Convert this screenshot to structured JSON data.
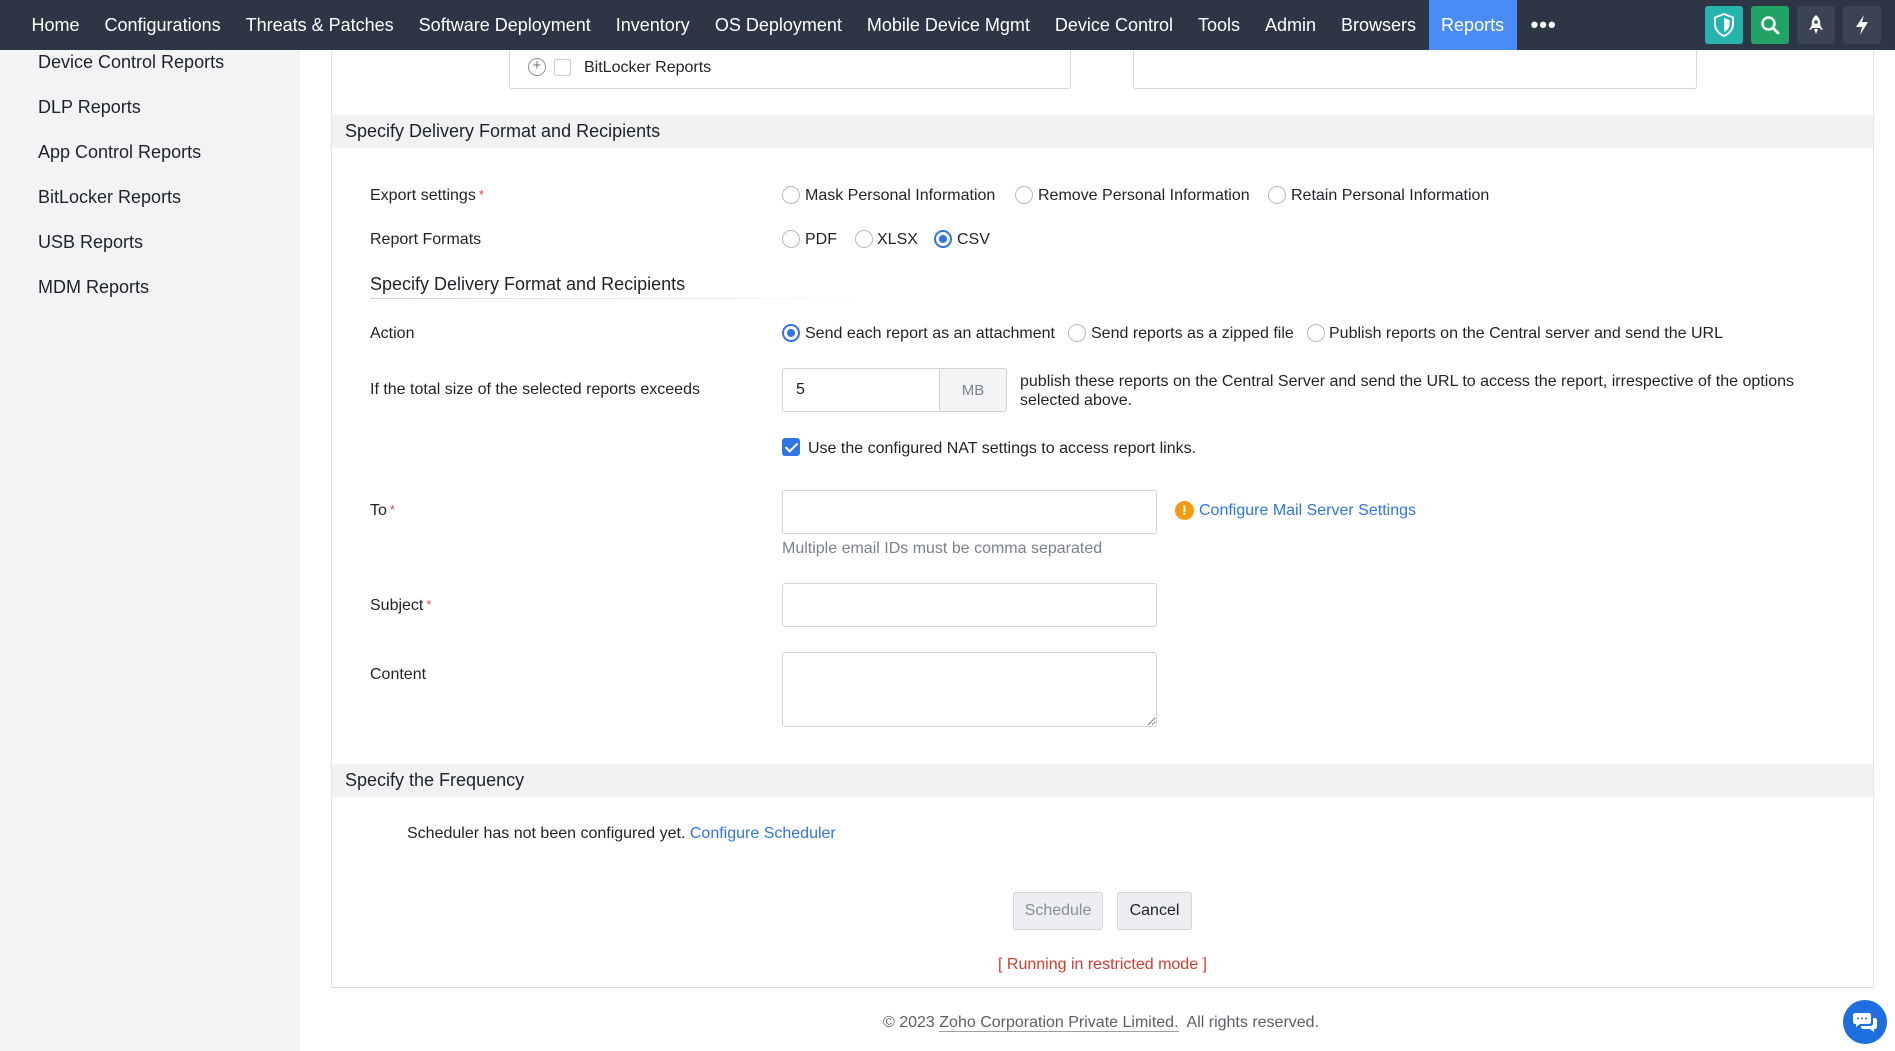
{
  "nav": {
    "items": [
      "Home",
      "Configurations",
      "Threats & Patches",
      "Software Deployment",
      "Inventory",
      "OS Deployment",
      "Mobile Device Mgmt",
      "Device Control",
      "Tools",
      "Admin",
      "Browsers",
      "Reports"
    ],
    "active": "Reports",
    "more_label": "•••",
    "icons": [
      "shield-icon",
      "search-icon",
      "rocket-icon",
      "bolt-icon"
    ],
    "colors": {
      "bar": "#2d3644",
      "active": "#4a8cf7",
      "shield": "#26b5ac",
      "search": "#21a366"
    }
  },
  "sidebar": {
    "items": [
      "Device Control Reports",
      "DLP Reports",
      "App Control Reports",
      "BitLocker Reports",
      "USB Reports",
      "MDM Reports"
    ]
  },
  "tree": {
    "item_label": "BitLocker Reports"
  },
  "delivery": {
    "section_title": "Specify Delivery Format and Recipients",
    "export_label": "Export settings",
    "export_options": [
      "Mask Personal Information",
      "Remove Personal Information",
      "Retain Personal Information"
    ],
    "format_label": "Report Formats",
    "format_options": [
      "PDF",
      "XLSX",
      "CSV"
    ],
    "format_selected": "CSV",
    "subheading": "Specify Delivery Format and Recipients",
    "action_label": "Action",
    "action_options": [
      "Send each report as an attachment",
      "Send reports as a zipped file",
      "Publish reports on the Central server and send the URL"
    ],
    "action_selected": "Send each report as an attachment",
    "size_label": "If the total size of the selected reports exceeds",
    "size_value": "5",
    "size_unit": "MB",
    "size_desc": "publish these reports on the Central Server and send the URL to access the report, irrespective of the options selected above.",
    "nat_label": "Use the configured NAT settings to access report links.",
    "nat_checked": true,
    "to_label": "To",
    "to_value": "",
    "to_hint": "Multiple email IDs must be comma separated",
    "mail_link": "Configure Mail Server Settings",
    "subject_label": "Subject",
    "subject_value": "",
    "content_label": "Content",
    "content_value": ""
  },
  "frequency": {
    "section_title": "Specify the Frequency",
    "message": "Scheduler has not been configured yet.",
    "link": "Configure Scheduler"
  },
  "actions": {
    "schedule_label": "Schedule",
    "cancel_label": "Cancel"
  },
  "status": {
    "restricted": "[ Running in restricted mode ]",
    "accent_color": "#d63a2f"
  },
  "footer": {
    "prefix": "© 2023 ",
    "company": "Zoho Corporation Private Limited.",
    "suffix": "  All rights reserved."
  },
  "theme": {
    "accent": "#2f75e6",
    "warning": "#f39c12"
  }
}
